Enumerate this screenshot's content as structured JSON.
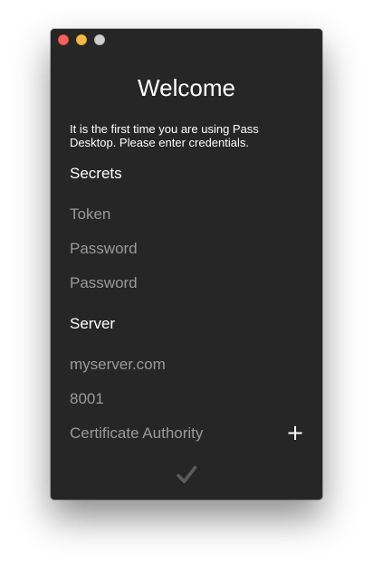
{
  "window": {
    "title": "Welcome",
    "intro": "It is the first time you are using Pass Desktop. Please enter credentials."
  },
  "secrets": {
    "heading": "Secrets",
    "token_placeholder": "Token",
    "password_placeholder": "Password",
    "password_confirm_placeholder": "Password"
  },
  "server": {
    "heading": "Server",
    "host_placeholder": "myserver.com",
    "port_placeholder": "8001",
    "ca_placeholder": "Certificate Authority",
    "add_ca_icon": "plus-icon"
  },
  "submit": {
    "icon": "checkmark-icon",
    "enabled": false
  },
  "colors": {
    "window_bg": "#262626",
    "text": "#ffffff",
    "placeholder": "#9a9a9a",
    "disabled_icon": "#5c5c5c",
    "close": "#fc605b",
    "minimize": "#fdbc40",
    "zoom": "#d0d0d0"
  }
}
